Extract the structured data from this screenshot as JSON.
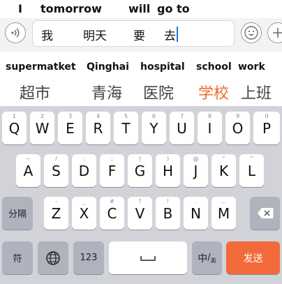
{
  "gloss": {
    "i": "I",
    "tomorrow": "tomorrow",
    "will": "will",
    "go_to": "go to"
  },
  "input": {
    "chars": [
      "我",
      "明天",
      "要",
      "去"
    ]
  },
  "candidate_gloss": [
    "supermatket",
    "Qinghai",
    "hospital",
    "school",
    "work"
  ],
  "candidates": [
    "超市",
    "青海",
    "医院",
    "学校",
    "上班"
  ],
  "keyboard": {
    "row1": [
      {
        "key": "Q",
        "hint": "1"
      },
      {
        "key": "W",
        "hint": "2"
      },
      {
        "key": "E",
        "hint": "3"
      },
      {
        "key": "R",
        "hint": "4"
      },
      {
        "key": "T",
        "hint": "5"
      },
      {
        "key": "Y",
        "hint": "6"
      },
      {
        "key": "U",
        "hint": "7"
      },
      {
        "key": "I",
        "hint": "8"
      },
      {
        "key": "O",
        "hint": "9"
      },
      {
        "key": "P",
        "hint": "0"
      }
    ],
    "row2": [
      {
        "key": "A",
        "hint": "~"
      },
      {
        "key": "S",
        "hint": "/"
      },
      {
        "key": "D",
        "hint": ":"
      },
      {
        "key": "F",
        "hint": ";"
      },
      {
        "key": "G",
        "hint": "("
      },
      {
        "key": "H",
        "hint": ")"
      },
      {
        "key": "J",
        "hint": "@"
      },
      {
        "key": "K",
        "hint": "“"
      },
      {
        "key": "L",
        "hint": "”"
      }
    ],
    "row3": [
      {
        "key": "Z",
        "hint": "-"
      },
      {
        "key": "X",
        "hint": "_"
      },
      {
        "key": "C",
        "hint": "#"
      },
      {
        "key": "V",
        "hint": "?"
      },
      {
        "key": "B",
        "hint": "!"
      },
      {
        "key": "N",
        "hint": "."
      },
      {
        "key": "M",
        "hint": "…"
      }
    ],
    "shift_label": "分隔",
    "symbol_label": "符",
    "num_label": "123",
    "lang_label": "中",
    "lang_sub": "英",
    "send_label": "发送"
  },
  "colors": {
    "accent": "#f06a2b",
    "send": "#f26a39",
    "caret": "#1e6fe8",
    "keyboard_bg": "#d1d3d9"
  }
}
